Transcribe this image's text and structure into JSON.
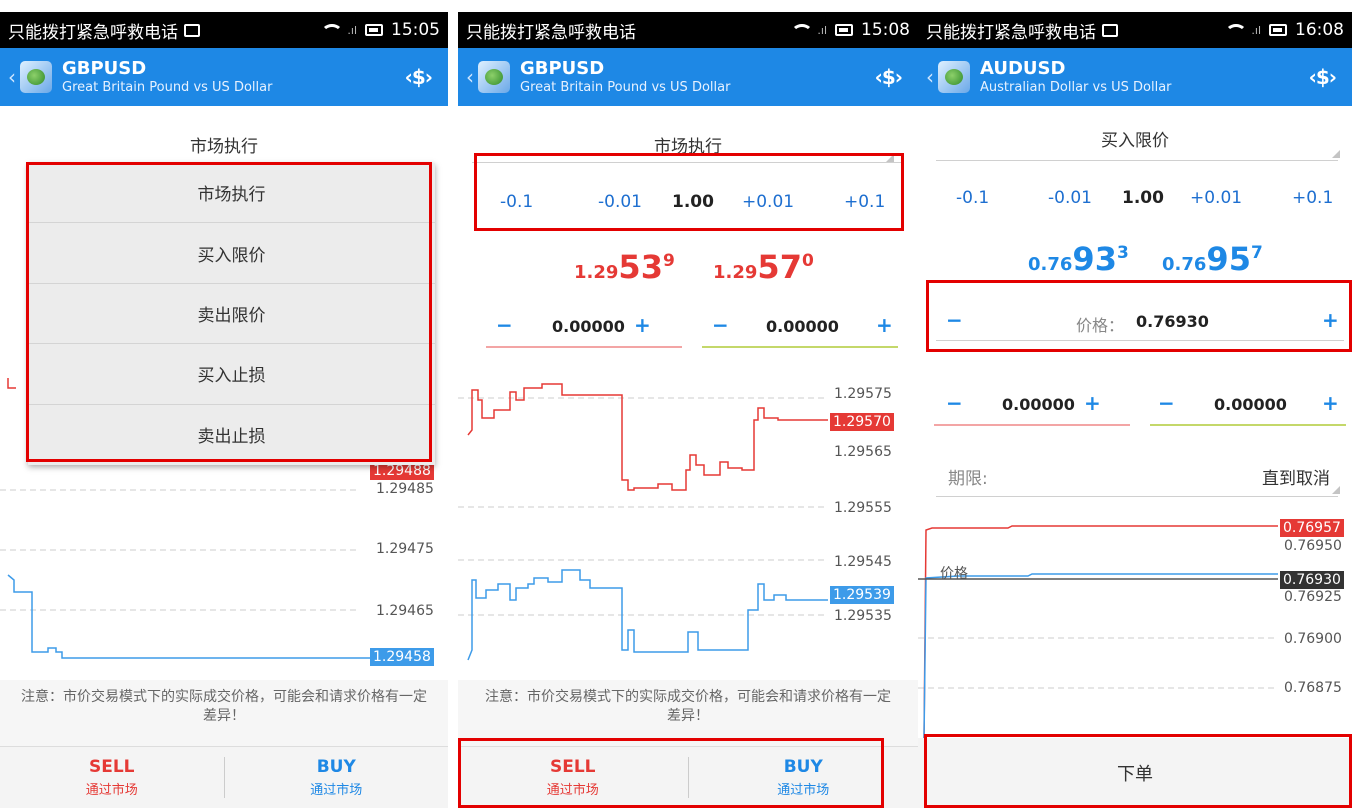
{
  "status_bar": {
    "carrier_text": "只能拨打紧急呼救电话",
    "times": [
      "15:05",
      "15:08",
      "16:08"
    ]
  },
  "screens": [
    {
      "symbol": "GBPUSD",
      "symbol_desc": "Great Britain Pound vs US Dollar",
      "order_type": "市场执行",
      "dropdown_options": [
        "市场执行",
        "买入限价",
        "卖出限价",
        "买入止损",
        "卖出止损"
      ],
      "chart_labels": [
        "1.29488",
        "1.29485",
        "1.29475",
        "1.29465",
        "1.29458"
      ],
      "notice": "注意：市价交易模式下的实际成交价格，可能会和请求价格有一定差异！",
      "sell_label": "SELL",
      "buy_label": "BUY",
      "via_market": "通过市场"
    },
    {
      "symbol": "GBPUSD",
      "symbol_desc": "Great Britain Pound vs US Dollar",
      "order_type": "市场执行",
      "volume_steps": [
        "-0.1",
        "-0.01",
        "1.00",
        "+0.01",
        "+0.1"
      ],
      "bid": {
        "prefix": "1.29",
        "big": "53",
        "sup": "9"
      },
      "ask": {
        "prefix": "1.29",
        "big": "57",
        "sup": "0"
      },
      "sl_value": "0.00000",
      "tp_value": "0.00000",
      "chart_labels": [
        "1.29575",
        "1.29570",
        "1.29565",
        "1.29555",
        "1.29545",
        "1.29539",
        "1.29535"
      ],
      "notice": "注意：市价交易模式下的实际成交价格，可能会和请求价格有一定差异！",
      "sell_label": "SELL",
      "buy_label": "BUY",
      "via_market": "通过市场"
    },
    {
      "symbol": "AUDUSD",
      "symbol_desc": "Australian Dollar vs US Dollar",
      "order_type": "买入限价",
      "volume_steps": [
        "-0.1",
        "-0.01",
        "1.00",
        "+0.01",
        "+0.1"
      ],
      "bid": {
        "prefix": "0.76",
        "big": "93",
        "sup": "3"
      },
      "ask": {
        "prefix": "0.76",
        "big": "95",
        "sup": "7"
      },
      "price_label": "价格：",
      "price_value": "0.76930",
      "sl_value": "0.00000",
      "tp_value": "0.00000",
      "expiry_label": "期限:",
      "expiry_value": "直到取消",
      "chart_price_line_label": "价格",
      "chart_labels": [
        "0.76957",
        "0.76950",
        "0.76930",
        "0.76925",
        "0.76900",
        "0.76875"
      ],
      "place_order": "下单"
    }
  ],
  "colors": {
    "appbar": "#1e88e5",
    "sell": "#e53935",
    "buy": "#1e88e5",
    "highlight": "#e30000"
  }
}
